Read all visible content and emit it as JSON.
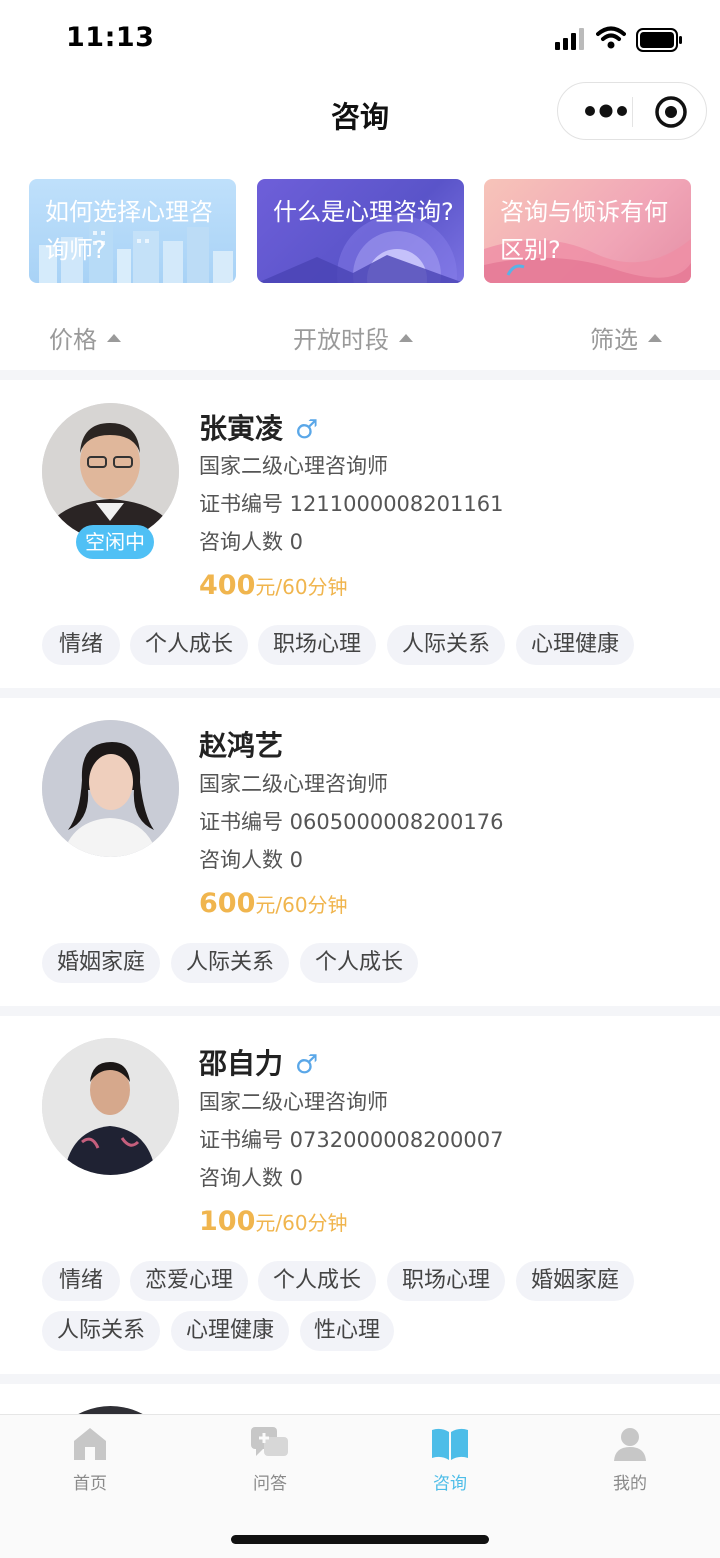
{
  "status_bar": {
    "time": "11:13"
  },
  "nav": {
    "title": "咨询"
  },
  "banners": [
    {
      "text": "如何选择心理咨询师?"
    },
    {
      "text": "什么是心理咨询?"
    },
    {
      "text": "咨询与倾诉有何区别?"
    }
  ],
  "sort": {
    "price": "价格",
    "time_slot": "开放时段",
    "filter": "筛选"
  },
  "counselors": [
    {
      "name": "张寅凌",
      "gender_icon": "male-icon",
      "title": "国家二级心理咨询师",
      "cert": "证书编号 121100000820116​1",
      "cert_text": "证书编号 1211000008201161",
      "count": "咨询人数 0",
      "price_value": "400",
      "price_unit": "元/60分钟",
      "status": "空闲中",
      "tags": [
        "情绪",
        "个人成长",
        "职场心理",
        "人际关系",
        "心理健康"
      ]
    },
    {
      "name": "赵鸿艺",
      "gender_icon": "",
      "title": "国家二级心理咨询师",
      "cert_text": "证书编号 0605000008200176",
      "count": "咨询人数 0",
      "price_value": "600",
      "price_unit": "元/60分钟",
      "status": "",
      "tags": [
        "婚姻家庭",
        "人际关系",
        "个人成长"
      ]
    },
    {
      "name": "邵自力",
      "gender_icon": "male-icon",
      "title": "国家二级心理咨询师",
      "cert_text": "证书编号 0732000008200007",
      "count": "咨询人数 0",
      "price_value": "100",
      "price_unit": "元/60分钟",
      "status": "",
      "tags": [
        "情绪",
        "恋爱心理",
        "个人成长",
        "职场心理",
        "婚姻家庭",
        "人际关系",
        "心理健康",
        "性心理"
      ]
    }
  ],
  "tabbar": {
    "items": [
      {
        "label": "首页",
        "icon": "home-icon"
      },
      {
        "label": "问答",
        "icon": "qa-icon"
      },
      {
        "label": "咨询",
        "icon": "book-icon"
      },
      {
        "label": "我的",
        "icon": "user-icon"
      }
    ],
    "active_index": 2,
    "active_color": "#4dbde8",
    "inactive_color": "#8a8a8a"
  },
  "colors": {
    "price": "#f0b54e",
    "status_pill": "#4fc0f5",
    "male": "#5aa7e8"
  }
}
